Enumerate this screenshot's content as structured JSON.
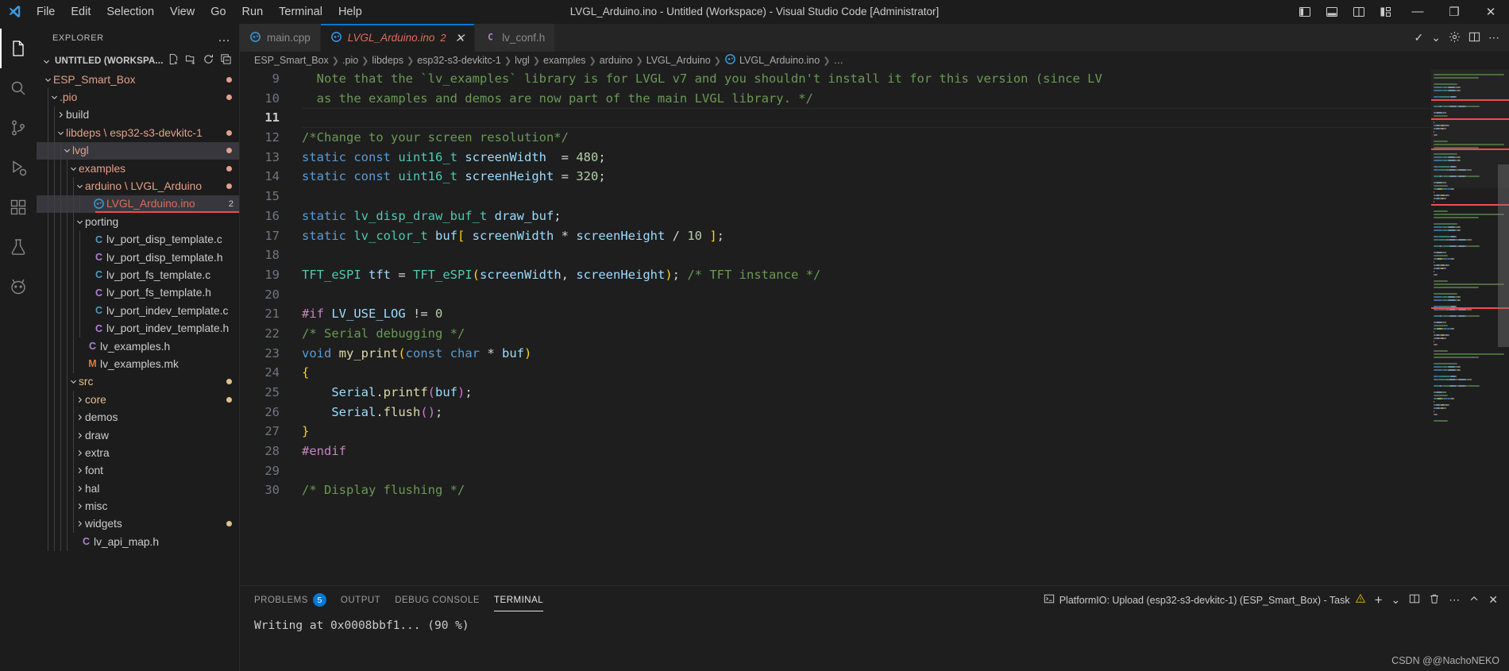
{
  "titlebar": {
    "logo_icon": "vscode-logo-icon",
    "title": "LVGL_Arduino.ino - Untitled (Workspace) - Visual Studio Code [Administrator]",
    "menus": [
      "File",
      "Edit",
      "Selection",
      "View",
      "Go",
      "Run",
      "Terminal",
      "Help"
    ],
    "layout_buttons": [
      {
        "name": "toggle-primary-sidebar-icon",
        "label": "◧"
      },
      {
        "name": "toggle-panel-icon",
        "label": "▤"
      },
      {
        "name": "toggle-secondary-sidebar-icon",
        "label": "◨"
      },
      {
        "name": "customize-layout-icon",
        "label": "▥"
      }
    ],
    "window_buttons": [
      {
        "name": "minimize-button",
        "label": "—"
      },
      {
        "name": "restore-button",
        "label": "❐"
      },
      {
        "name": "close-button",
        "label": "✕"
      }
    ]
  },
  "activitybar": {
    "items": [
      {
        "name": "explorer",
        "icon": "files-icon",
        "active": true
      },
      {
        "name": "search",
        "icon": "search-icon",
        "active": false
      },
      {
        "name": "source-control",
        "icon": "source-control-icon",
        "active": false
      },
      {
        "name": "run-and-debug",
        "icon": "debug-icon",
        "active": false
      },
      {
        "name": "extensions",
        "icon": "extensions-icon",
        "active": false
      },
      {
        "name": "testing",
        "icon": "beaker-icon",
        "active": false
      },
      {
        "name": "platformio",
        "icon": "platformio-alien-icon",
        "active": false
      }
    ]
  },
  "sidebar": {
    "title": "EXPLORER",
    "more_actions": "…",
    "workspace": {
      "label": "UNTITLED (WORKSPA...",
      "actions": [
        "new-file-icon",
        "new-folder-icon",
        "refresh-icon",
        "collapse-all-icon"
      ]
    },
    "tree": [
      {
        "label": "ESP_Smart_Box",
        "depth": 0,
        "kind": "folder",
        "open": true,
        "color": "#e2a08a",
        "dot": "#e2a08a"
      },
      {
        "label": ".pio",
        "depth": 1,
        "kind": "folder",
        "open": true,
        "color": "#e2a08a",
        "dot": "#e2a08a"
      },
      {
        "label": "build",
        "depth": 2,
        "kind": "folder",
        "open": false,
        "color": "#cccccc",
        "dot": ""
      },
      {
        "label": "libdeps \\ esp32-s3-devkitc-1",
        "depth": 2,
        "kind": "folder",
        "open": true,
        "color": "#e2a08a",
        "dot": "#e2a08a"
      },
      {
        "label": "lvgl",
        "depth": 3,
        "kind": "folder",
        "open": true,
        "color": "#e2a08a",
        "dot": "#e2a08a",
        "highlight": true
      },
      {
        "label": "examples",
        "depth": 4,
        "kind": "folder",
        "open": true,
        "color": "#e2a08a",
        "dot": "#e2a08a"
      },
      {
        "label": "arduino \\ LVGL_Arduino",
        "depth": 5,
        "kind": "folder",
        "open": true,
        "color": "#e2a08a",
        "dot": "#e2a08a"
      },
      {
        "label": "LVGL_Arduino.ino",
        "depth": 6,
        "kind": "ino",
        "color": "#e06c5b",
        "selected": true,
        "badge": "2",
        "error": true
      },
      {
        "label": "porting",
        "depth": 5,
        "kind": "folder",
        "open": true,
        "color": "#cccccc",
        "dot": ""
      },
      {
        "label": "lv_port_disp_template.c",
        "depth": 6,
        "kind": "c",
        "color": "#cccccc"
      },
      {
        "label": "lv_port_disp_template.h",
        "depth": 6,
        "kind": "h",
        "color": "#cccccc"
      },
      {
        "label": "lv_port_fs_template.c",
        "depth": 6,
        "kind": "c",
        "color": "#cccccc"
      },
      {
        "label": "lv_port_fs_template.h",
        "depth": 6,
        "kind": "h",
        "color": "#cccccc"
      },
      {
        "label": "lv_port_indev_template.c",
        "depth": 6,
        "kind": "c",
        "color": "#cccccc"
      },
      {
        "label": "lv_port_indev_template.h",
        "depth": 6,
        "kind": "h",
        "color": "#cccccc"
      },
      {
        "label": "lv_examples.h",
        "depth": 5,
        "kind": "h",
        "color": "#cccccc"
      },
      {
        "label": "lv_examples.mk",
        "depth": 5,
        "kind": "mk",
        "color": "#cccccc"
      },
      {
        "label": "src",
        "depth": 4,
        "kind": "folder",
        "open": true,
        "color": "#e2c08d",
        "dot": "#e2c08d"
      },
      {
        "label": "core",
        "depth": 5,
        "kind": "folder",
        "open": false,
        "color": "#e2c08d",
        "dot": "#e2c08d"
      },
      {
        "label": "demos",
        "depth": 5,
        "kind": "folder",
        "open": false,
        "color": "#cccccc",
        "dot": ""
      },
      {
        "label": "draw",
        "depth": 5,
        "kind": "folder",
        "open": false,
        "color": "#cccccc",
        "dot": ""
      },
      {
        "label": "extra",
        "depth": 5,
        "kind": "folder",
        "open": false,
        "color": "#cccccc",
        "dot": ""
      },
      {
        "label": "font",
        "depth": 5,
        "kind": "folder",
        "open": false,
        "color": "#cccccc",
        "dot": ""
      },
      {
        "label": "hal",
        "depth": 5,
        "kind": "folder",
        "open": false,
        "color": "#cccccc",
        "dot": ""
      },
      {
        "label": "misc",
        "depth": 5,
        "kind": "folder",
        "open": false,
        "color": "#cccccc",
        "dot": ""
      },
      {
        "label": "widgets",
        "depth": 5,
        "kind": "folder",
        "open": false,
        "color": "#cccccc",
        "dot": "#e2c08d"
      },
      {
        "label": "lv_api_map.h",
        "depth": 4,
        "kind": "h",
        "color": "#cccccc"
      }
    ]
  },
  "tabs": [
    {
      "label": "main.cpp",
      "icon": "ino-icon",
      "active": false,
      "badge": "",
      "close": ""
    },
    {
      "label": "LVGL_Arduino.ino",
      "icon": "ino-icon",
      "active": true,
      "badge": "2",
      "close": "✕"
    },
    {
      "label": "lv_conf.h",
      "icon": "h-icon",
      "active": false,
      "badge": "",
      "close": ""
    }
  ],
  "tabs_actions": [
    {
      "name": "check-all-icon",
      "label": "✓"
    },
    {
      "name": "chevron-down-icon",
      "label": "⌄"
    },
    {
      "name": "debug-run-icon",
      "label": "⚙"
    },
    {
      "name": "split-editor-icon",
      "label": "◫"
    },
    {
      "name": "more-actions-icon",
      "label": "⋯"
    }
  ],
  "breadcrumbs": [
    "ESP_Smart_Box",
    ".pio",
    "libdeps",
    "esp32-s3-devkitc-1",
    "lvgl",
    "examples",
    "arduino",
    "LVGL_Arduino",
    "LVGL_Arduino.ino",
    "…"
  ],
  "breadcrumb_icon": "ino-icon",
  "editor": {
    "first_line": 9,
    "current_line": 11,
    "lines": [
      {
        "n": 9,
        "bp": true,
        "tokens": [
          {
            "t": "  Note that the `lv_examples` library is for LVGL v7 and you shouldn't install it for this version (since LV",
            "c": "t-com"
          }
        ]
      },
      {
        "n": 10,
        "bp": true,
        "tokens": [
          {
            "t": "  as the examples and demos are now part of the main LVGL library. */",
            "c": "t-com"
          }
        ]
      },
      {
        "n": 11,
        "bp": false,
        "tokens": []
      },
      {
        "n": 12,
        "bp": true,
        "err": true,
        "tokens": [
          {
            "t": "/*Change to your screen resolution*/",
            "c": "t-com"
          }
        ]
      },
      {
        "n": 13,
        "bp": true,
        "tokens": [
          {
            "t": "static const ",
            "c": "t-key"
          },
          {
            "t": "uint16_t ",
            "c": "t-type"
          },
          {
            "t": "screenWidth",
            "c": "t-var"
          },
          {
            "t": "  = ",
            "c": "t-op"
          },
          {
            "t": "480",
            "c": "t-num"
          },
          {
            "t": ";",
            "c": "t-op"
          }
        ]
      },
      {
        "n": 14,
        "bp": true,
        "tokens": [
          {
            "t": "static const ",
            "c": "t-key"
          },
          {
            "t": "uint16_t ",
            "c": "t-type"
          },
          {
            "t": "screenHeight",
            "c": "t-var"
          },
          {
            "t": " = ",
            "c": "t-op"
          },
          {
            "t": "320",
            "c": "t-num"
          },
          {
            "t": ";",
            "c": "t-op"
          }
        ]
      },
      {
        "n": 15,
        "bp": false,
        "tokens": []
      },
      {
        "n": 16,
        "bp": true,
        "tokens": [
          {
            "t": "static ",
            "c": "t-key"
          },
          {
            "t": "lv_disp_draw_buf_t ",
            "c": "t-type"
          },
          {
            "t": "draw_buf",
            "c": "t-var"
          },
          {
            "t": ";",
            "c": "t-op"
          }
        ]
      },
      {
        "n": 17,
        "bp": true,
        "tokens": [
          {
            "t": "static ",
            "c": "t-key"
          },
          {
            "t": "lv_color_t ",
            "c": "t-type"
          },
          {
            "t": "buf",
            "c": "t-var"
          },
          {
            "t": "[",
            "c": "t-br1"
          },
          {
            "t": " ",
            "c": "t-op"
          },
          {
            "t": "screenWidth",
            "c": "t-var"
          },
          {
            "t": " * ",
            "c": "t-op"
          },
          {
            "t": "screenHeight",
            "c": "t-var"
          },
          {
            "t": " / ",
            "c": "t-op"
          },
          {
            "t": "10",
            "c": "t-num"
          },
          {
            "t": " ",
            "c": "t-op"
          },
          {
            "t": "]",
            "c": "t-br1"
          },
          {
            "t": ";",
            "c": "t-op"
          }
        ]
      },
      {
        "n": 18,
        "bp": false,
        "tokens": []
      },
      {
        "n": 19,
        "bp": true,
        "tokens": [
          {
            "t": "TFT_eSPI ",
            "c": "t-type"
          },
          {
            "t": "tft",
            "c": "t-var"
          },
          {
            "t": " = ",
            "c": "t-op"
          },
          {
            "t": "TFT_eSPI",
            "c": "t-type"
          },
          {
            "t": "(",
            "c": "t-br1"
          },
          {
            "t": "screenWidth",
            "c": "t-var"
          },
          {
            "t": ", ",
            "c": "t-op"
          },
          {
            "t": "screenHeight",
            "c": "t-var"
          },
          {
            "t": ")",
            "c": "t-br1"
          },
          {
            "t": "; ",
            "c": "t-op"
          },
          {
            "t": "/* TFT instance */",
            "c": "t-com"
          }
        ]
      },
      {
        "n": 20,
        "bp": false,
        "tokens": []
      },
      {
        "n": 21,
        "bp": true,
        "tokens": [
          {
            "t": "#if ",
            "c": "t-pre"
          },
          {
            "t": "LV_USE_LOG",
            "c": "t-var"
          },
          {
            "t": " != ",
            "c": "t-op"
          },
          {
            "t": "0",
            "c": "t-num"
          }
        ]
      },
      {
        "n": 22,
        "bp": true,
        "tokens": [
          {
            "t": "/* Serial debugging */",
            "c": "t-com"
          }
        ]
      },
      {
        "n": 23,
        "bp": true,
        "tokens": [
          {
            "t": "void ",
            "c": "t-key"
          },
          {
            "t": "my_print",
            "c": "t-fn"
          },
          {
            "t": "(",
            "c": "t-br1"
          },
          {
            "t": "const ",
            "c": "t-key"
          },
          {
            "t": "char ",
            "c": "t-key"
          },
          {
            "t": "* ",
            "c": "t-op"
          },
          {
            "t": "buf",
            "c": "t-var"
          },
          {
            "t": ")",
            "c": "t-br1"
          }
        ]
      },
      {
        "n": 24,
        "bp": true,
        "tokens": [
          {
            "t": "{",
            "c": "t-br1"
          }
        ]
      },
      {
        "n": 25,
        "bp": true,
        "tokens": [
          {
            "t": "    ",
            "c": "t-op"
          },
          {
            "t": "Serial",
            "c": "t-var"
          },
          {
            "t": ".",
            "c": "t-op"
          },
          {
            "t": "printf",
            "c": "t-fn"
          },
          {
            "t": "(",
            "c": "t-br2"
          },
          {
            "t": "buf",
            "c": "t-var"
          },
          {
            "t": ")",
            "c": "t-br2"
          },
          {
            "t": ";",
            "c": "t-op"
          }
        ]
      },
      {
        "n": 26,
        "bp": true,
        "tokens": [
          {
            "t": "    ",
            "c": "t-op"
          },
          {
            "t": "Serial",
            "c": "t-var"
          },
          {
            "t": ".",
            "c": "t-op"
          },
          {
            "t": "flush",
            "c": "t-fn"
          },
          {
            "t": "(",
            "c": "t-br2"
          },
          {
            "t": ")",
            "c": "t-br2"
          },
          {
            "t": ";",
            "c": "t-op"
          }
        ]
      },
      {
        "n": 27,
        "bp": true,
        "tokens": [
          {
            "t": "}",
            "c": "t-br1"
          }
        ]
      },
      {
        "n": 28,
        "bp": true,
        "tokens": [
          {
            "t": "#endif",
            "c": "t-pre"
          }
        ]
      },
      {
        "n": 29,
        "bp": false,
        "tokens": []
      },
      {
        "n": 30,
        "bp": true,
        "tokens": [
          {
            "t": "/* Display flushing */",
            "c": "t-com"
          }
        ]
      }
    ]
  },
  "panel": {
    "tabs": [
      {
        "label": "PROBLEMS",
        "badge": "5",
        "active": false
      },
      {
        "label": "OUTPUT",
        "badge": "",
        "active": false
      },
      {
        "label": "DEBUG CONSOLE",
        "badge": "",
        "active": false
      },
      {
        "label": "TERMINAL",
        "badge": "",
        "active": true
      }
    ],
    "task": "PlatformIO: Upload (esp32-s3-devkitc-1) (ESP_Smart_Box) - Task",
    "task_icon": "terminal-icon",
    "task_warn_icon": "warning-icon",
    "actions": [
      {
        "name": "new-terminal-icon",
        "label": "+"
      },
      {
        "name": "terminal-dropdown-icon",
        "label": "⌄"
      },
      {
        "name": "split-terminal-icon",
        "label": "▯"
      },
      {
        "name": "kill-terminal-icon",
        "label": "🗑"
      },
      {
        "name": "panel-more-actions-icon",
        "label": "⋯"
      },
      {
        "name": "maximize-panel-icon",
        "label": "⌃"
      },
      {
        "name": "close-panel-icon",
        "label": "✕"
      }
    ],
    "terminal_output": "Writing at 0x0008bbf1... (90 %)"
  },
  "watermark": "CSDN @@NachoNEKO",
  "colors": {
    "accent": "#0078d4",
    "error": "#f14c4c",
    "modified": "#e2a08a",
    "untracked": "#e2c08d",
    "editor_bg": "#1e1e1e",
    "sidebar_bg": "#1c1c1c"
  }
}
